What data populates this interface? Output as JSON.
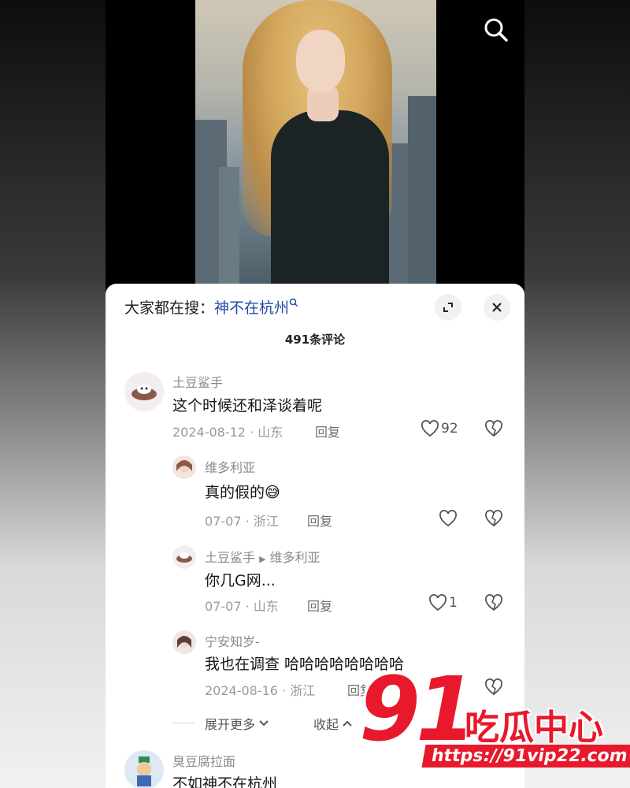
{
  "header": {
    "search_prefix": "大家都在搜：",
    "search_link": "神不在杭州",
    "comment_count": "491条评论"
  },
  "comments": [
    {
      "username": "土豆鲨手",
      "text": "这个时候还和泽谈着呢",
      "date": "2024-08-12",
      "region": "山东",
      "reply_label": "回复",
      "likes": "92"
    },
    {
      "username": "维多利亚",
      "text": "真的假的😅",
      "date": "07-07",
      "region": "浙江",
      "reply_label": "回复",
      "likes": ""
    },
    {
      "username": "土豆鲨手",
      "reply_to": "维多利亚",
      "text": "你几G网...",
      "date": "07-07",
      "region": "山东",
      "reply_label": "回复",
      "likes": "1"
    },
    {
      "username": "宁安知岁-",
      "text": "我也在调查  哈哈哈哈哈哈哈哈",
      "date": "2024-08-16",
      "region": "浙江",
      "reply_label": "回复",
      "likes": ""
    },
    {
      "username": "臭豆腐拉面",
      "text": "不如神不在杭州"
    }
  ],
  "thread": {
    "expand_more": "展开更多",
    "collapse": "收起"
  },
  "watermark": {
    "number": "91",
    "brand": "吃瓜中心",
    "url": "https://91vip22.com"
  },
  "icons": {
    "search": "search-icon",
    "expand": "expand-icon",
    "close": "close-icon",
    "like": "heart-icon",
    "dislike": "broken-heart-icon"
  },
  "colors": {
    "link": "#1f4aa8",
    "watermark_red": "#e8192c"
  }
}
